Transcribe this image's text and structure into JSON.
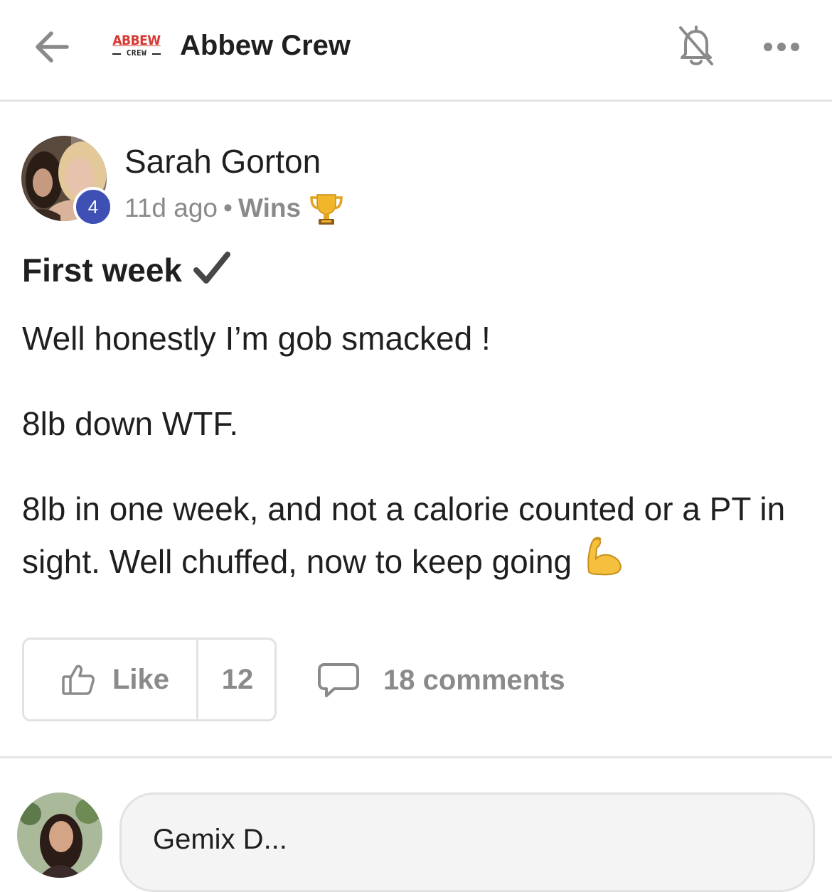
{
  "header": {
    "back_icon": "arrow-left-icon",
    "logo": {
      "top": "ABBEW",
      "bottom": "CREW"
    },
    "title": "Abbew Crew",
    "notifications_icon": "bell-off-icon",
    "more_icon": "more-horizontal-icon"
  },
  "post": {
    "author": "Sarah Gorton",
    "level": "4",
    "time": "11d ago",
    "separator": "•",
    "category": "Wins",
    "category_icon": "trophy-emoji",
    "title": "First week",
    "title_icon": "check-mark-emoji",
    "body": [
      "Well honestly I’m gob smacked !",
      "8lb down WTF.",
      "8lb in one week, and not a calorie counted or a PT in sight. Well chuffed, now to keep going"
    ],
    "body_end_icon": "flexed-biceps-emoji"
  },
  "actions": {
    "like_label": "Like",
    "like_count": "12",
    "comments_label": "18 comments"
  },
  "next_comment": {
    "author": "Gemix D..."
  },
  "colors": {
    "badge": "#3e50b4",
    "logo_red": "#d63a34",
    "muted_text": "#8a8a8a",
    "divider": "#e3e3e3"
  }
}
